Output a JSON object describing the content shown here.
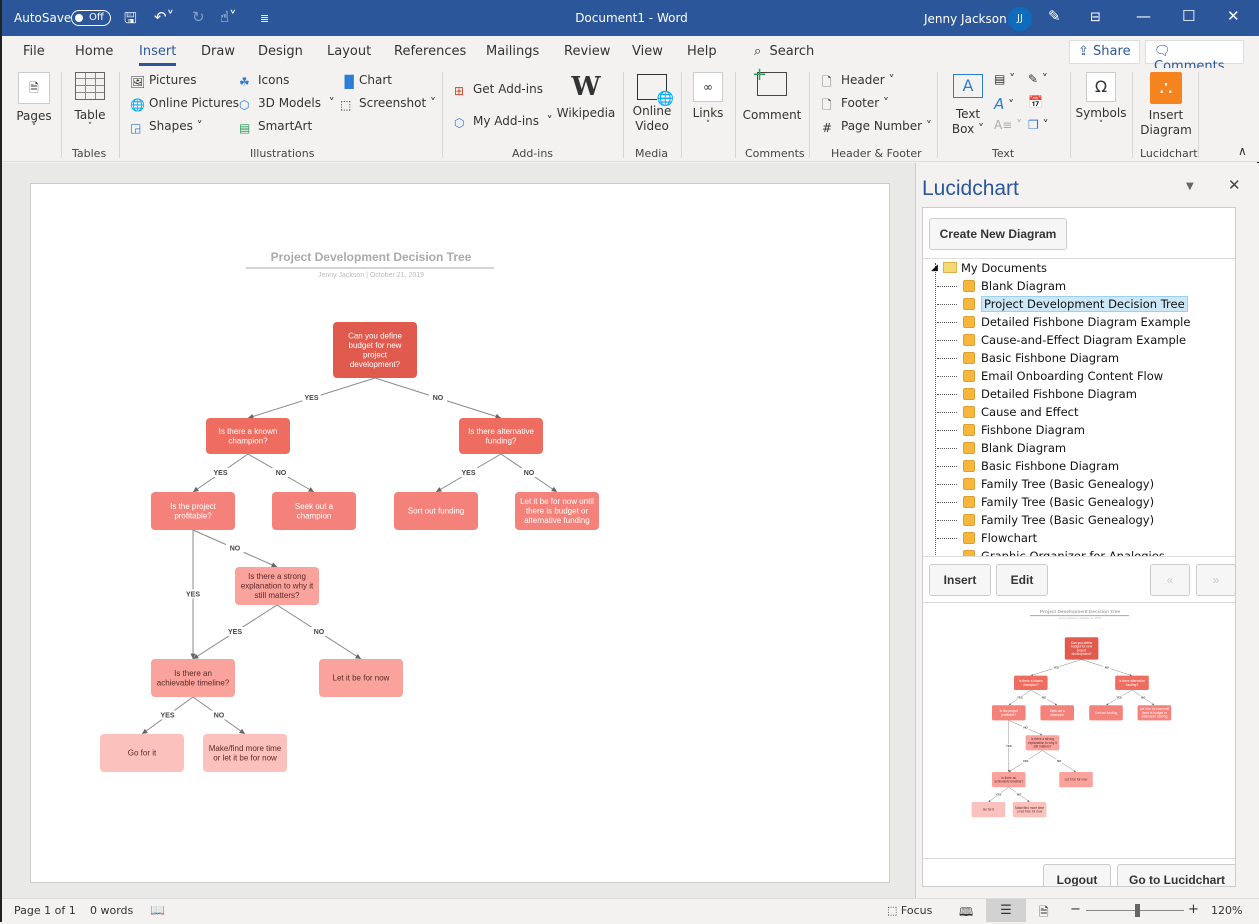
{
  "titlebar": {
    "autosave_label": "AutoSave",
    "autosave_state": "Off",
    "document_title": "Document1  -  Word",
    "user_name": "Jenny Jackson",
    "user_initials": "JJ"
  },
  "tabs": [
    "File",
    "Home",
    "Insert",
    "Draw",
    "Design",
    "Layout",
    "References",
    "Mailings",
    "Review",
    "View",
    "Help"
  ],
  "active_tab": "Insert",
  "search_label": "Search",
  "share_label": "Share",
  "comments_label": "Comments",
  "ribbon": {
    "pages": "Pages",
    "table": "Table",
    "tables_group": "Tables",
    "pictures": "Pictures",
    "online_pictures": "Online Pictures",
    "shapes": "Shapes",
    "icons": "Icons",
    "models_3d": "3D Models",
    "smartart": "SmartArt",
    "chart": "Chart",
    "screenshot": "Screenshot",
    "illustrations_group": "Illustrations",
    "get_addins": "Get Add-ins",
    "my_addins": "My Add-ins",
    "wikipedia": "Wikipedia",
    "addins_group": "Add-ins",
    "online_video_1": "Online",
    "online_video_2": "Video",
    "media_group": "Media",
    "links": "Links",
    "comment": "Comment",
    "comments_group": "Comments",
    "header": "Header",
    "footer": "Footer",
    "page_number": "Page Number",
    "header_footer_group": "Header & Footer",
    "text_box_1": "Text",
    "text_box_2": "Box",
    "text_group": "Text",
    "symbols": "Symbols",
    "insert_diagram_1": "Insert",
    "insert_diagram_2": "Diagram",
    "lucidchart_group": "Lucidchart"
  },
  "diagram": {
    "title": "Project Development Decision Tree",
    "subtitle": "Jenny Jackson  |  October 21, 2019",
    "nodes": [
      {
        "id": "n1",
        "lines": [
          "Can you define",
          "budget for new",
          "project",
          "development?"
        ],
        "color": "#e05a4e"
      },
      {
        "id": "n2",
        "lines": [
          "Is there a known",
          "champion?"
        ],
        "color": "#ee6d60"
      },
      {
        "id": "n3",
        "lines": [
          "Is there alternative",
          "funding?"
        ],
        "color": "#ee6d60"
      },
      {
        "id": "n4",
        "lines": [
          "Is the project",
          "profitable?"
        ],
        "color": "#f5827a"
      },
      {
        "id": "n5",
        "lines": [
          "Seek out a",
          "champion"
        ],
        "color": "#f5827a"
      },
      {
        "id": "n6",
        "lines": [
          "Sort out funding"
        ],
        "color": "#f5827a"
      },
      {
        "id": "n7",
        "lines": [
          "Let it be for now until",
          "there is budget or",
          "alternative funding"
        ],
        "color": "#f5827a"
      },
      {
        "id": "n8",
        "lines": [
          "Is there a strong",
          "explanation to why it",
          "still matters?"
        ],
        "color": "#f9a39c"
      },
      {
        "id": "n9",
        "lines": [
          "Is there an",
          "achievable timeline?"
        ],
        "color": "#f9a39c"
      },
      {
        "id": "n10",
        "lines": [
          "Let it be for now"
        ],
        "color": "#f9a39c"
      },
      {
        "id": "n11",
        "lines": [
          "Go for it"
        ],
        "color": "#fbc2bd"
      },
      {
        "id": "n12",
        "lines": [
          "Make/find more time",
          "or let it be for now"
        ],
        "color": "#fbc2bd"
      }
    ],
    "edges": [
      {
        "from": "n1",
        "to": "n2",
        "label": "YES"
      },
      {
        "from": "n1",
        "to": "n3",
        "label": "NO"
      },
      {
        "from": "n2",
        "to": "n4",
        "label": "YES"
      },
      {
        "from": "n2",
        "to": "n5",
        "label": "NO"
      },
      {
        "from": "n3",
        "to": "n6",
        "label": "YES"
      },
      {
        "from": "n3",
        "to": "n7",
        "label": "NO"
      },
      {
        "from": "n4",
        "to": "n9",
        "label": "YES"
      },
      {
        "from": "n4",
        "to": "n8",
        "label": "NO"
      },
      {
        "from": "n8",
        "to": "n9",
        "label": "YES"
      },
      {
        "from": "n8",
        "to": "n10",
        "label": "NO"
      },
      {
        "from": "n9",
        "to": "n11",
        "label": "YES"
      },
      {
        "from": "n9",
        "to": "n12",
        "label": "NO"
      }
    ]
  },
  "pane": {
    "title": "Lucidchart",
    "create_button": "Create New Diagram",
    "folder": "My Documents",
    "documents": [
      "Blank Diagram",
      "Project Development Decision Tree",
      "Detailed Fishbone Diagram Example",
      "Cause-and-Effect Diagram Example",
      "Basic Fishbone Diagram",
      "Email Onboarding Content Flow",
      "Detailed Fishbone Diagram",
      "Cause and Effect",
      "Fishbone Diagram",
      "Blank Diagram",
      "Basic Fishbone Diagram",
      "Family Tree (Basic Genealogy)",
      "Family Tree (Basic Genealogy)",
      "Family Tree (Basic Genealogy)",
      "Flowchart",
      "Graphic Organizer for Analogies"
    ],
    "selected_index": 1,
    "insert_button": "Insert",
    "edit_button": "Edit",
    "prev_button": "«",
    "next_button": "»",
    "logout_button": "Logout",
    "goto_button": "Go to Lucidchart"
  },
  "statusbar": {
    "page": "Page 1 of 1",
    "words": "0 words",
    "focus": "Focus",
    "zoom": "120%",
    "zoom_level_percent": 120
  }
}
